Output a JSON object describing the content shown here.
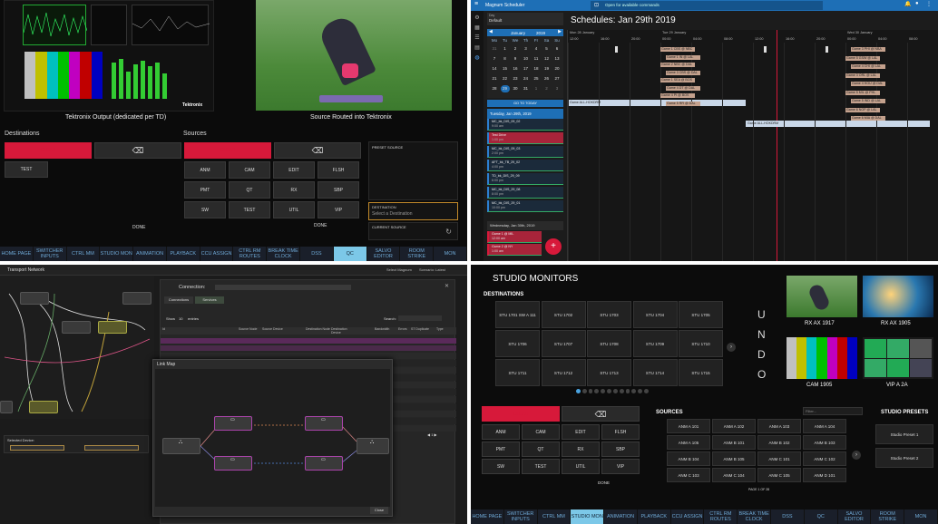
{
  "q1": {
    "preview_left_label": "Tektronix Output (dedicated per TD)",
    "preview_right_label": "Source Routed into Tektronix",
    "destinations_title": "Destinations",
    "sources_title": "Sources",
    "dest_clear": "CLEAR",
    "src_clear": "CLEAR",
    "dest_test": "TEST",
    "sources": [
      "ANM",
      "CAM",
      "EDIT",
      "FLSH",
      "PMT",
      "QT",
      "RX",
      "SBP",
      "SW",
      "TEST",
      "UTIL",
      "VIP"
    ],
    "done_left": "DONE",
    "done_right": "DONE",
    "preset_source": "PRESET SOURCE",
    "destination_label": "DESTINATION",
    "destination_placeholder": "Select a Destination",
    "current_source": "CURRENT SOURCE",
    "nav": [
      "HOME PAGE",
      "SWITCHER INPUTS",
      "CTRL MM",
      "STUDIO MON",
      "ANIMATION",
      "PLAYBACK",
      "CCU ASSIGN",
      "CTRL RM ROUTES",
      "BREAK TIME CLOCK",
      "DSS",
      "QC",
      "SALVO EDITOR",
      "ROOM STRIKE",
      "MON"
    ],
    "nav_active": 10
  },
  "q2": {
    "app_title": "Magnum Scheduler",
    "command_hint": "Open for available commands",
    "sched_title": "Schedules: Jan 29th 2019",
    "filter_label": "Day",
    "filter_value": "Default",
    "month": "January",
    "year": "2019",
    "weekdays": [
      "Mo",
      "Tu",
      "We",
      "Th",
      "Fr",
      "Sa",
      "Su"
    ],
    "days": [
      "31",
      "1",
      "2",
      "3",
      "4",
      "5",
      "6",
      "7",
      "8",
      "9",
      "10",
      "11",
      "12",
      "13",
      "14",
      "15",
      "16",
      "17",
      "18",
      "19",
      "20",
      "21",
      "22",
      "23",
      "24",
      "25",
      "26",
      "27",
      "28",
      "29",
      "30",
      "31",
      "1",
      "2",
      "3"
    ],
    "day_headers": [
      "Mon 28 January",
      "Tue 29 January",
      "Wed 30 January"
    ],
    "times": [
      "12:00",
      "16:00",
      "20:00",
      "00:00",
      "04:00",
      "08:00",
      "12:00",
      "16:00",
      "20:00",
      "00:00",
      "04:00",
      "08:00"
    ],
    "list_header": "Tuesday, Jan 29th, 2019",
    "list_header2": "Wednesday, Jan 30th, 2019",
    "go_today": "GO TO TODAY",
    "items": [
      {
        "name": "MC_bk_DIS_09_02",
        "time": "9:00 am"
      },
      {
        "name": "Test Drive",
        "time": "1:00 pm"
      },
      {
        "name": "MC_bk_DIS_09_03",
        "time": "2:00 pm"
      },
      {
        "name": "AFT_bk_TB_29_02",
        "time": "4:00 pm"
      },
      {
        "name": "TD_bk_DIS_29_09",
        "time": "6:00 pm"
      },
      {
        "name": "MC_bk_DIS_29_08",
        "time": "8:00 pm"
      },
      {
        "name": "MC_bk_DIS_29_01",
        "time": "10:00 pm"
      }
    ],
    "items2": [
      {
        "name": "Game 1 @ MIL",
        "time": "12:00 am"
      },
      {
        "name": "Game 2 @ NY",
        "time": "1:00 am"
      }
    ],
    "events_left": [
      "Game 1 CBS @ NBC",
      "Game 1 IN @ LAL",
      "Game 2 NBC @ DAL",
      "Game 3 CBS @ DAL",
      "Game 1 SEA @ BOS",
      "Game 4 DT @ DAL",
      "Game 4 Pt @ BOS",
      "Game 5 RR @ DAL"
    ],
    "events_right": [
      "Game 3 PHI @ NBA",
      "Game 5 GSW @ LAL",
      "Game 4 CHI @ LAL",
      "Game 3 ORL @ LAL",
      "Game 4 HOU @ DAL",
      "Game 5 MIL @ PHL",
      "Game 5 IND @ LAL",
      "Game 6 NOP @ LAL",
      "Game 6 MIA @ DAL"
    ],
    "long_bar": "Game ALL-HOKDRM",
    "long_bar2": "Game ALL-HOKDRM",
    "fab": "+"
  },
  "q3": {
    "title": "Transport Network",
    "connection_label": "Connection:",
    "tab1": "Connections",
    "tab2": "Services",
    "show_label": "Show",
    "show_value": "10",
    "entries_label": "entries",
    "search_label": "Search:",
    "col_headers": [
      "Id",
      "Source Node",
      "Source Device",
      "Destination Node",
      "Destination Device",
      "Bandwidth",
      "Errors",
      "ST Duplicate",
      "Type"
    ],
    "link_map": "Link Map",
    "close": "Close",
    "selected_device": "Selected Device:",
    "top_btn1": "Select Magnum",
    "top_btn2": "Scenario: Latest"
  },
  "q4": {
    "title": "STUDIO MONITORS",
    "destinations": "DESTINATIONS",
    "dest_tiles": [
      "STU 1701 SW A 111",
      "STU 1702",
      "STU 1703",
      "STU 1704",
      "STU 1705",
      "STU 1706",
      "STU 1707",
      "STU 1708",
      "STU 1709",
      "STU 1710",
      "STU 1711",
      "STU 1712",
      "STU 1713",
      "STU 1714",
      "STU 1715"
    ],
    "undo": [
      "U",
      "N",
      "D",
      "O"
    ],
    "previews": [
      "RX AX 1917",
      "RX AX 1905",
      "CAM 1905",
      "VIP A 2A"
    ],
    "clear": "CLEAR",
    "sources_grid": [
      "ANM",
      "CAM",
      "EDIT",
      "FLSH",
      "PMT",
      "QT",
      "RX",
      "SBP",
      "SW",
      "TEST",
      "UTIL",
      "VIP"
    ],
    "done": "DONE",
    "sources_title": "SOURCES",
    "filter_placeholder": "Filter...",
    "source_tiles": [
      "ANM A 101",
      "ANM A 102",
      "ANM A 103",
      "ANM A 104",
      "ANM A 105",
      "ANM B 101",
      "ANM B 102",
      "ANM B 103",
      "ANM B 104",
      "ANM B 105",
      "ANM C 101",
      "ANM C 102",
      "ANM C 103",
      "ANM C 104",
      "ANM C 105",
      "ANM D 101"
    ],
    "page": "PAGE 1 OF 28",
    "presets_title": "STUDIO PRESETS",
    "presets": [
      "Studio Preset 1",
      "Studio Preset 2"
    ],
    "nav": [
      "HOME PAGE",
      "SWITCHER INPUTS",
      "CTRL MM",
      "STUDIO MON",
      "ANIMATION",
      "PLAYBACK",
      "CCU ASSIGN",
      "CTRL RM ROUTES",
      "BREAK TIME CLOCK",
      "DSS",
      "QC",
      "SALVO EDITOR",
      "ROOM STRIKE",
      "MON"
    ],
    "nav_active": 3
  },
  "colors": {
    "accent_red": "#d7193a",
    "nav_active": "#7cc8e8",
    "sched_blue": "#1e6fb6"
  }
}
